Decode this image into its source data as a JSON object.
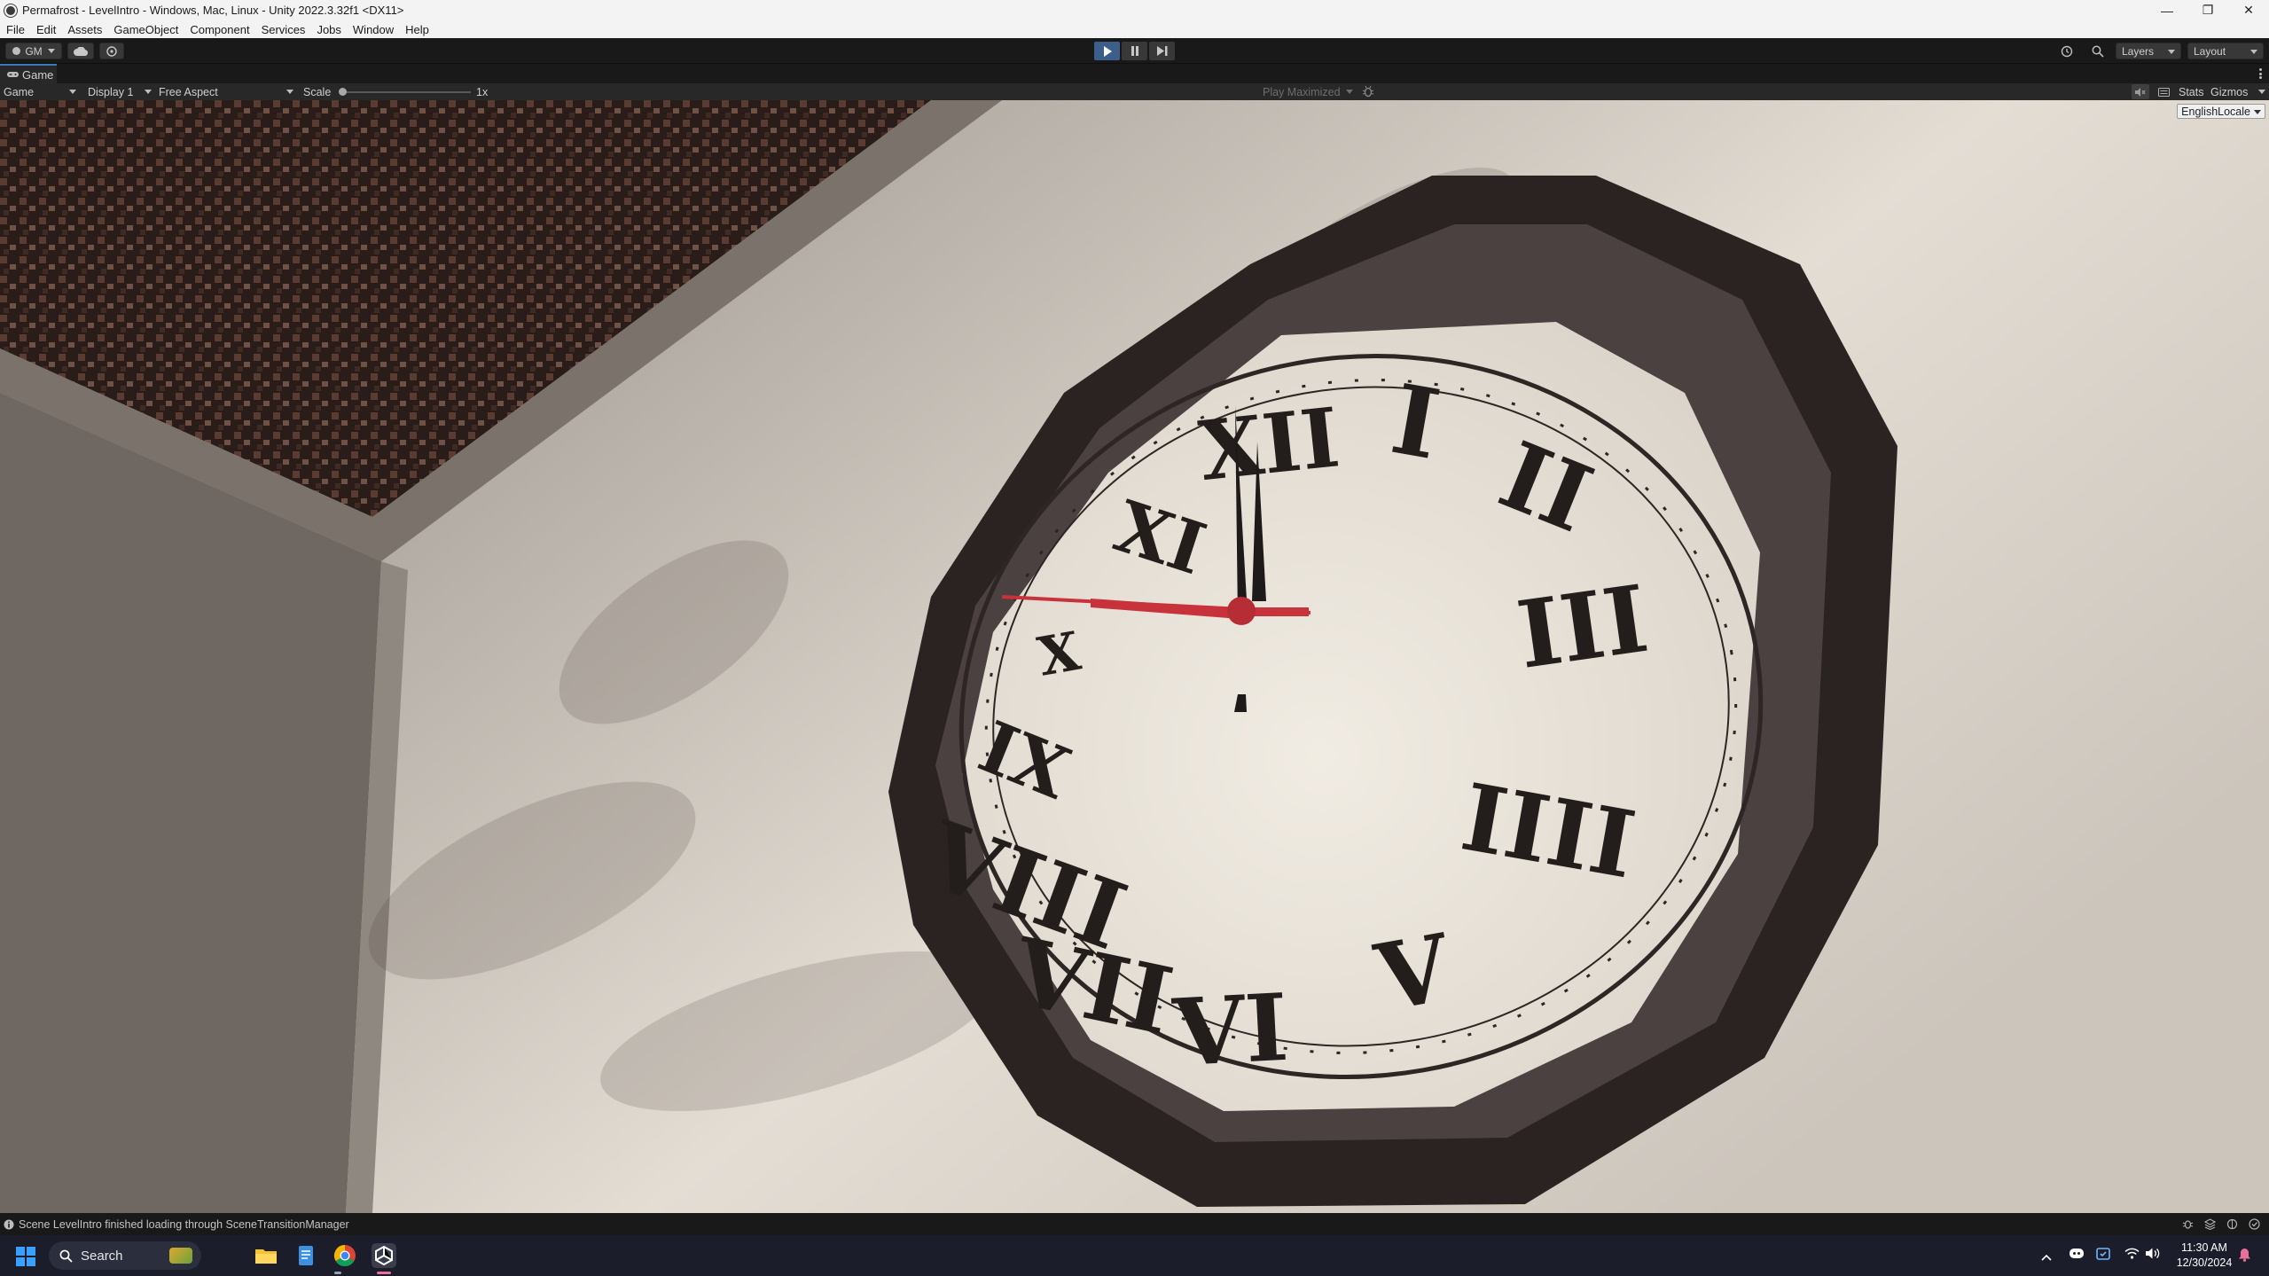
{
  "window": {
    "title": "Permafrost - LevelIntro - Windows, Mac, Linux - Unity 2022.3.32f1 <DX11>",
    "controls": [
      "—",
      "❐",
      "✕"
    ]
  },
  "menu": [
    "File",
    "Edit",
    "Assets",
    "GameObject",
    "Component",
    "Services",
    "Jobs",
    "Window",
    "Help"
  ],
  "toolbar": {
    "account": "GM",
    "layers_label": "Layers",
    "layout_label": "Layout"
  },
  "tabs": {
    "game": "Game"
  },
  "game_toolbar": {
    "view": "Game",
    "display": "Display 1",
    "aspect": "Free Aspect",
    "scale_label": "Scale",
    "scale_value": "1x",
    "scale_level": 0.0,
    "play_mode": "Play Maximized",
    "stats": "Stats",
    "gizmos": "Gizmos"
  },
  "viewport": {
    "locale": "EnglishLocale",
    "clock_numerals": [
      "I",
      "II",
      "III",
      "IIII",
      "V",
      "VI",
      "VII",
      "VIII",
      "IX",
      "X",
      "XI",
      "XII"
    ],
    "colors": {
      "second_hand": "#c8323b",
      "frame": "#2b2322",
      "face": "#efe9df"
    }
  },
  "status": {
    "message": "Scene LevelIntro finished loading through SceneTransitionManager"
  },
  "taskbar": {
    "search_placeholder": "Search",
    "time": "11:30 AM",
    "date": "12/30/2024"
  }
}
